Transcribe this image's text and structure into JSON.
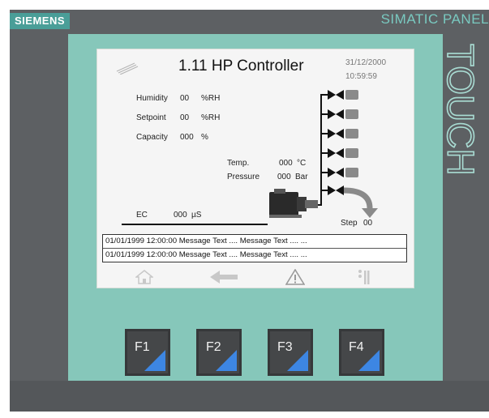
{
  "brand": {
    "name": "SIEMENS",
    "product": "SIMATIC PANEL",
    "model": "TOUCH"
  },
  "screen": {
    "title": "1.11 HP Controller",
    "date": "31/12/2000",
    "time": "10:59:59",
    "fields": [
      {
        "label": "Humidity",
        "value": "00",
        "unit": "%RH"
      },
      {
        "label": "Setpoint",
        "value": "00",
        "unit": "%RH"
      },
      {
        "label": "Capacity",
        "value": "000",
        "unit": "%"
      }
    ],
    "temp": {
      "label": "Temp.",
      "value": "000",
      "unit": "°C"
    },
    "pressure": {
      "label": "Pressure",
      "value": "000",
      "unit": "Bar"
    },
    "ec": {
      "label": "EC",
      "value": "000",
      "unit": "µS"
    },
    "step": {
      "label": "Step",
      "value": "00"
    },
    "messages": [
      "01/01/1999 12:00:00 Message Text .... Message Text .... ...",
      "01/01/1999 12:00:00 Message Text .... Message Text .... ..."
    ],
    "nav": [
      "home-icon",
      "back-arrow-icon",
      "warning-icon",
      "info-icon"
    ]
  },
  "function_keys": [
    "F1",
    "F2",
    "F3",
    "F4"
  ],
  "colors": {
    "bezel": "#5d6063",
    "panel_green": "#86c7ba",
    "brand_teal": "#4a9e98",
    "key_accent": "#3d86e3"
  }
}
